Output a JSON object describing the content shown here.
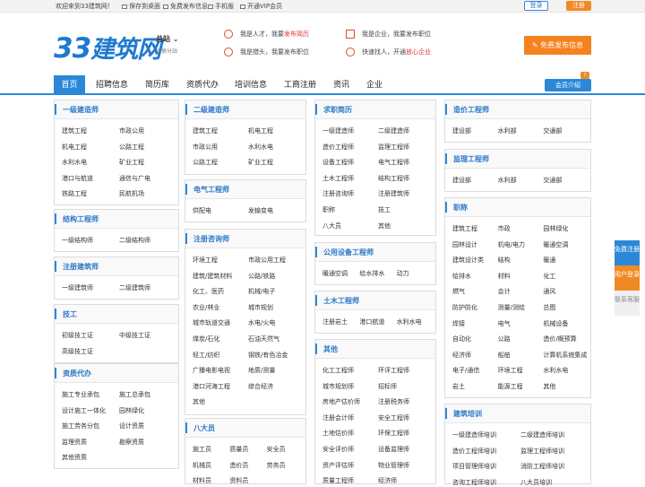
{
  "topbar": {
    "welcome": "欢迎来到33建筑网！",
    "save_desktop": "保存到桌面",
    "free_post": "免费发布信息",
    "mobile": "手机版",
    "vip": "开通VIP会员",
    "login": "登录",
    "register": "注册"
  },
  "logo": {
    "num": "33",
    "text": "建筑网"
  },
  "city": {
    "name": "总站",
    "sub": "切换分站"
  },
  "promos": [
    {
      "pre": "我是人才，我要",
      "hl": "发布简历"
    },
    {
      "pre": "我是企业，我要",
      "hl": "发布职位"
    },
    {
      "pre": "我是猎头，我要",
      "hl": "发布职位"
    },
    {
      "pre": "快速找人，开通",
      "hl": "放心企业"
    }
  ],
  "publish_button": "免费发布信息",
  "nav": {
    "items": [
      "首页",
      "招聘信息",
      "简历库",
      "资质代办",
      "培训信息",
      "工商注册",
      "资讯",
      "企业"
    ],
    "member": "会员介绍",
    "badge": "?"
  },
  "sidebar": [
    {
      "label": "免费注册",
      "color": "#2b88d8"
    },
    {
      "label": "用户登录",
      "color": "#f08a24"
    },
    {
      "label": "联系客服",
      "color": "#e8e8e8"
    }
  ],
  "boxes": [
    {
      "title": "一级建造师",
      "items": [
        "建筑工程",
        "市政公用",
        "机电工程",
        "公路工程",
        "水利水电",
        "矿业工程",
        "港口与航道",
        "通信与广电",
        "铁路工程",
        "民航机场"
      ]
    },
    {
      "title": "结构工程师",
      "items": [
        "一级结构师",
        "二级结构师"
      ]
    },
    {
      "title": "注册建筑师",
      "items": [
        "一级建筑师",
        "二级建筑师"
      ]
    },
    {
      "title": "技工",
      "items": [
        "初级技工证",
        "中级技工证",
        "高级技工证"
      ]
    },
    {
      "title": "资质代办",
      "items": [
        "施工专业承包",
        "施工总承包",
        "设计施工一体化",
        "园林绿化",
        "施工劳务分包",
        "设计资质",
        "监理资质",
        "勘察资质",
        "其他资质"
      ]
    },
    {
      "title": "二级建造师",
      "items": [
        "建筑工程",
        "机电工程",
        "市政公用",
        "水利水电",
        "公路工程",
        "矿业工程"
      ]
    },
    {
      "title": "电气工程师",
      "items": [
        "供配电",
        "发输变电"
      ]
    },
    {
      "title": "注册咨询师",
      "items": [
        "环境工程",
        "市政公用工程",
        "建筑/建筑材料",
        "公路/铁路",
        "化工、医药",
        "机械/电子",
        "农业/林业",
        "城市规划",
        "城市轨道交通",
        "水电/火电",
        "煤炭/石化",
        "石油天然气",
        "轻工/纺织",
        "钢铁/有色冶金",
        "广播电影电视",
        "地质/测量",
        "港口河海工程",
        "综合经济",
        "其他"
      ]
    },
    {
      "title": "八大员",
      "items": [
        "施工员",
        "质量员",
        "安全员",
        "机械员",
        "造价员",
        "劳务员",
        "材料员",
        "资料员"
      ]
    },
    {
      "title": "求职简历",
      "items": [
        "一级建造师",
        "二级建造师",
        "造价工程师",
        "监理工程师",
        "设备工程师",
        "电气工程师",
        "土木工程师",
        "结构工程师",
        "注册咨询师",
        "注册建筑师",
        "职称",
        "技工",
        "八大员",
        "其他"
      ]
    },
    {
      "title": "公用设备工程师",
      "items": [
        "暖通空调",
        "给水排水",
        "动力"
      ]
    },
    {
      "title": "土木工程师",
      "items": [
        "注册岩土",
        "港口航道",
        "水利水电"
      ]
    },
    {
      "title": "其他",
      "items": [
        "化工工程师",
        "环评工程师",
        "城市规划师",
        "招标师",
        "房地产估价师",
        "注册税务师",
        "注册会计师",
        "安全工程师",
        "土地估价师",
        "环保工程师",
        "安全评价师",
        "设备监理师",
        "资产评估师",
        "物业管理师",
        "质量工程师",
        "经济师"
      ]
    },
    {
      "title": "造价工程师",
      "items": [
        "建设部",
        "水利部",
        "交通部"
      ]
    },
    {
      "title": "监理工程师",
      "items": [
        "建设部",
        "水利部",
        "交通部"
      ]
    },
    {
      "title": "职称",
      "items": [
        "建筑工程",
        "市政",
        "园林绿化",
        "园林设计",
        "机电/电力",
        "暖通空调",
        "建筑设计类",
        "结构",
        "暖通",
        "给排水",
        "材料",
        "化工",
        "燃气",
        "会计",
        "通风",
        "防护防化",
        "测量/测绘",
        "总图",
        "焊接",
        "电气",
        "机械设备",
        "自动化",
        "公路",
        "造价/概预算",
        "经济师",
        "船舶",
        "计算机系统集成",
        "电子/通信",
        "环境工程",
        "水利水电",
        "岩土",
        "能源工程",
        "其他"
      ]
    },
    {
      "title": "建筑培训",
      "items": [
        "一级建造师培训",
        "二级建造师培训",
        "造价工程师培训",
        "监理工程师培训",
        "项目管理师培训",
        "消防工程师培训",
        "咨询工程师培训",
        "八大员培训"
      ]
    }
  ]
}
